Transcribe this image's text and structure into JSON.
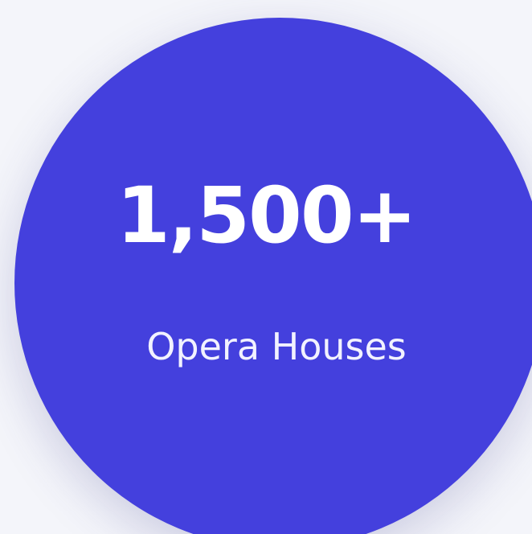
{
  "stat": {
    "value": "1,500+",
    "label": "Opera Houses"
  },
  "colors": {
    "background": "#f4f5fa",
    "circle": "#4440dd",
    "text": "#ffffff"
  }
}
